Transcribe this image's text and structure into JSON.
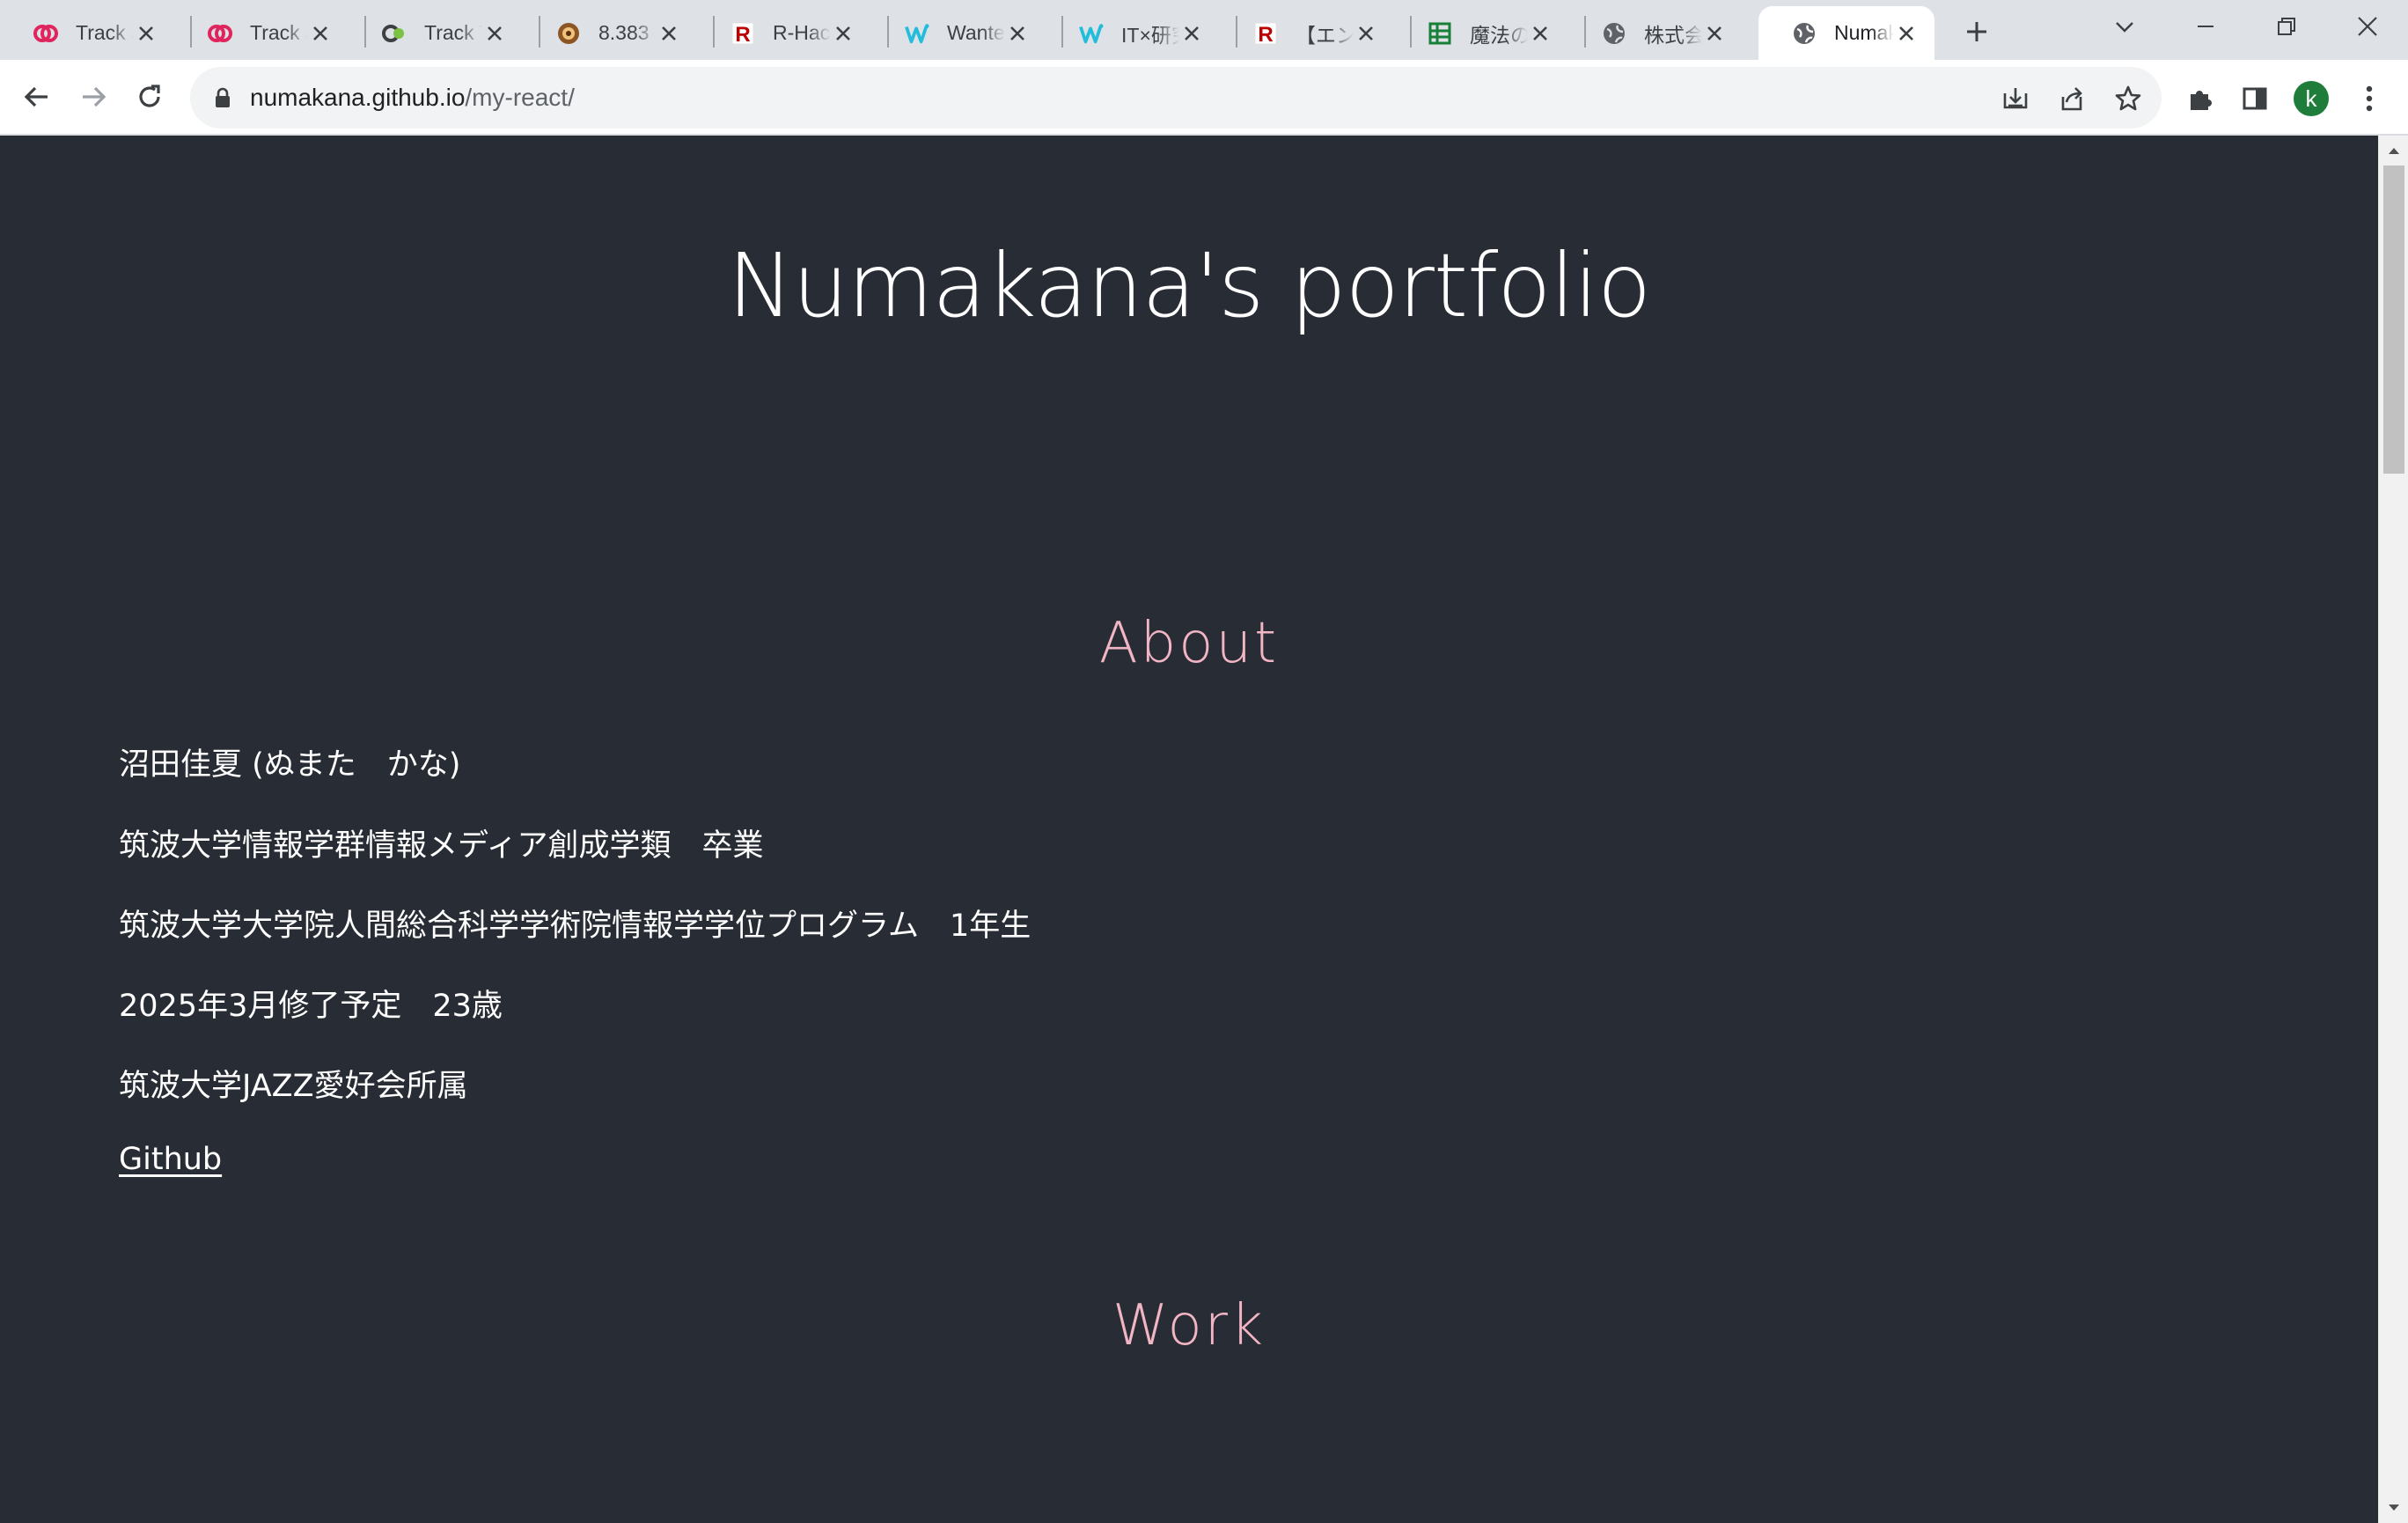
{
  "browser": {
    "tabs": [
      {
        "title": "Track Job",
        "favicon": "track-icon",
        "color": "#e0245e"
      },
      {
        "title": "Track Job",
        "favicon": "track-icon",
        "color": "#e0245e"
      },
      {
        "title": "Track Test",
        "favicon": "track-test-icon",
        "color": "#3c4043"
      },
      {
        "title": "8.383",
        "favicon": "cookie-icon",
        "color": "#8d5524"
      },
      {
        "title": "R-Hack",
        "favicon": "rakuten-icon",
        "color": "#bf0000"
      },
      {
        "title": "Wanted",
        "favicon": "wantedly-icon",
        "color": "#21bddb"
      },
      {
        "title": "IT×研究",
        "favicon": "wantedly-icon",
        "color": "#21bddb"
      },
      {
        "title": "【エントリー】",
        "favicon": "rakuten-icon",
        "color": "#bf0000"
      },
      {
        "title": "魔法の",
        "favicon": "sheets-icon",
        "color": "#188038"
      },
      {
        "title": "株式会社",
        "favicon": "globe-icon",
        "color": "#5f6368"
      },
      {
        "title": "Numakana's portfolio",
        "favicon": "globe-icon",
        "color": "#5f6368",
        "active": true
      }
    ],
    "url_host": "numakana.github.io",
    "url_path": "/my-react/",
    "profile_initial": "k",
    "profile_color": "#1e7d3a"
  },
  "page": {
    "title": "Numakana's portfolio",
    "about": {
      "heading": "About",
      "lines": [
        "沼田佳夏 (ぬまた　かな)",
        "筑波大学情報学群情報メディア創成学類　卒業",
        "筑波大学大学院人間総合科学学術院情報学学位プログラム　1年生",
        "2025年3月修了予定　23歳",
        "筑波大学JAZZ愛好会所属"
      ],
      "link_label": "Github"
    },
    "work": {
      "heading": "Work"
    },
    "background_color": "#282c34",
    "heading_accent_color": "#f2b5c4"
  }
}
